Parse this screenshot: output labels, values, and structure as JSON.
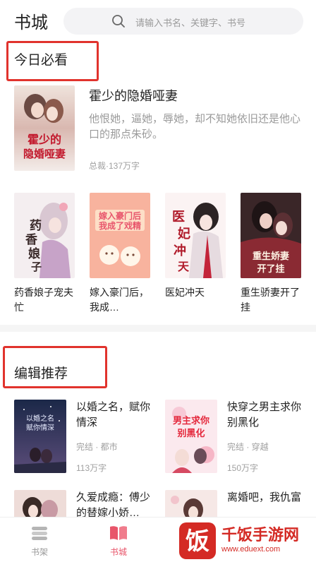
{
  "header": {
    "title": "书城",
    "search_placeholder": "请输入书名、关键字、书号"
  },
  "today": {
    "section_title": "今日必看",
    "featured": {
      "name": "霍少的隐婚哑妻",
      "description": "他恨她，逼她，辱她，却不知她依旧还是他心口的那点朱砂。",
      "meta": "总裁·137万字",
      "cover_title": "霍少的隐婚哑妻"
    },
    "books": [
      {
        "name": "药香娘子宠夫忙",
        "cover_title": "药香娘子"
      },
      {
        "name": "嫁入豪门后，我成…",
        "cover_title": "嫁入豪门后我成了戏精"
      },
      {
        "name": "医妃冲天",
        "cover_title": "医妃冲天"
      },
      {
        "name": "重生骄妻开了挂",
        "cover_title": "重生娇妻开了挂"
      }
    ]
  },
  "editor": {
    "section_title": "编辑推荐",
    "books": [
      {
        "name": "以婚之名，赋你情深",
        "meta": "完结 · 都市",
        "words": "113万字"
      },
      {
        "name": "快穿之男主求你别黑化",
        "meta": "完结 · 穿越",
        "words": "150万字",
        "cover_title": "男主求你别黑化"
      },
      {
        "name": "久爱成瘾：傅少的替嫁小娇…",
        "meta": "",
        "words": ""
      },
      {
        "name": "离婚吧，我仇富",
        "meta": "",
        "words": ""
      }
    ]
  },
  "tabbar": {
    "shelf_label": "书架",
    "store_label": "书城"
  },
  "watermark": {
    "name": "千饭手游网",
    "url": "www.eduext.com"
  },
  "colors": {
    "accent": "#e1332d",
    "tab_active": "#e8556a",
    "tab_inactive": "#999999"
  }
}
